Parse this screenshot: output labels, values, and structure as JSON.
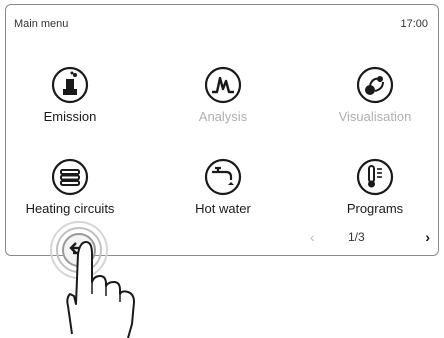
{
  "header": {
    "title": "Main menu",
    "time": "17:00"
  },
  "tiles": [
    {
      "label": "Emission",
      "icon": "emission-icon",
      "enabled": true
    },
    {
      "label": "Analysis",
      "icon": "analysis-icon",
      "enabled": false
    },
    {
      "label": "Visualisation",
      "icon": "visualisation-icon",
      "enabled": false
    },
    {
      "label": "Heating circuits",
      "icon": "heating-circuits-icon",
      "enabled": true
    },
    {
      "label": "Hot water",
      "icon": "hot-water-icon",
      "enabled": true
    },
    {
      "label": "Programs",
      "icon": "programs-icon",
      "enabled": true
    }
  ],
  "pager": {
    "prev": "‹",
    "page": "1/3",
    "next": "›"
  },
  "back": {
    "icon": "back-arrow-icon"
  },
  "colors": {
    "frame": "#8a8a8a",
    "text": "#1a1a1a",
    "disabled": "#b0b0b0"
  }
}
